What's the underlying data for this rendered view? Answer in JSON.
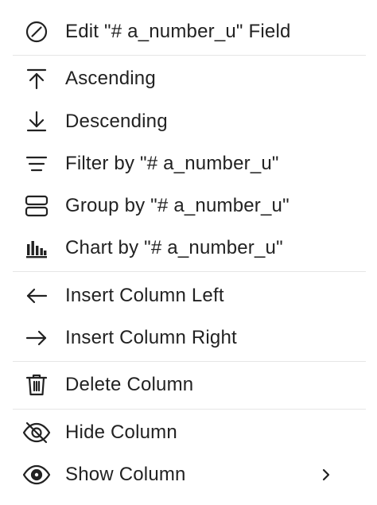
{
  "menu": {
    "items": [
      {
        "label": "Edit \"# a_number_u\" Field",
        "icon": "edit-circle-icon"
      },
      {
        "label": "Ascending",
        "icon": "sort-ascending-icon"
      },
      {
        "label": "Descending",
        "icon": "sort-descending-icon"
      },
      {
        "label": "Filter by \"# a_number_u\"",
        "icon": "filter-icon"
      },
      {
        "label": "Group by \"# a_number_u\"",
        "icon": "group-icon"
      },
      {
        "label": "Chart by \"# a_number_u\"",
        "icon": "bar-chart-icon"
      },
      {
        "label": "Insert Column Left",
        "icon": "arrow-left-icon"
      },
      {
        "label": "Insert Column Right",
        "icon": "arrow-right-icon"
      },
      {
        "label": "Delete Column",
        "icon": "trash-icon"
      },
      {
        "label": "Hide Column",
        "icon": "eye-off-icon"
      },
      {
        "label": "Show Column",
        "icon": "eye-icon",
        "submenu_icon": "chevron-right-icon"
      }
    ]
  }
}
